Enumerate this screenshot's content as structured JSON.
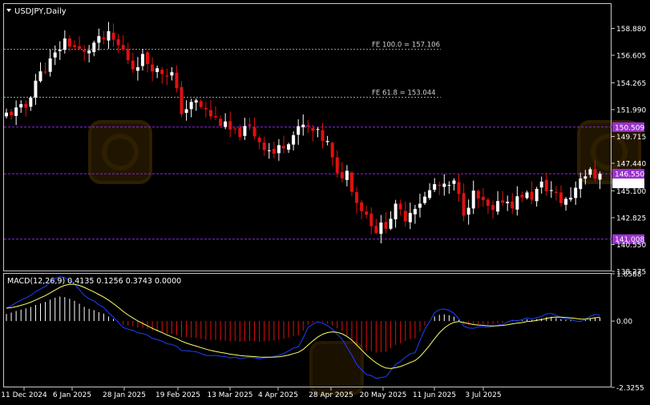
{
  "window": {
    "symbol_title": "USDJPY,Daily",
    "macd_label": "MACD(12,26,9) 0.4135 0.1256 0.3743 0.0000"
  },
  "colors": {
    "background": "#000000",
    "frame": "#c8c8c8",
    "bull": "#ffffff",
    "bear": "#e01010",
    "level_line": "#8a2be2",
    "level_label_bg": "#9932cc",
    "current_price_bg": "#ffffff",
    "fib_line": "#9a9a9a",
    "macd_hist_pos": "#ffffff",
    "macd_hist_neg": "#e01010",
    "macd_line": "#1e40ff",
    "signal_line": "#ffff66",
    "watermark": "#2a1c00"
  },
  "chart_data": [
    {
      "type": "candlestick",
      "symbol": "USDJPY",
      "timeframe": "Daily",
      "ylim": [
        138.275,
        160.95
      ],
      "y_ticks": [
        "158.880",
        "156.605",
        "154.265",
        "151.990",
        "149.715",
        "147.440",
        "145.100",
        "142.825",
        "140.550",
        "138.275"
      ],
      "x_ticks": [
        "11 Dec 2024",
        "6 Jan 2025",
        "28 Jan 2025",
        "19 Feb 2025",
        "13 Mar 2025",
        "4 Apr 2025",
        "28 Apr 2025",
        "20 May 2025",
        "11 Jun 2025",
        "3 Jul 2025"
      ],
      "anchors": [
        [
          0,
          151.6
        ],
        [
          4,
          152.2
        ],
        [
          6,
          154.5
        ],
        [
          10,
          156.6
        ],
        [
          12,
          157.9
        ],
        [
          16,
          156.7
        ],
        [
          18,
          157.6
        ],
        [
          21,
          158.2
        ],
        [
          24,
          157.0
        ],
        [
          26,
          155.6
        ],
        [
          28,
          156.4
        ],
        [
          31,
          155.3
        ],
        [
          34,
          155.0
        ],
        [
          36,
          151.9
        ],
        [
          39,
          152.6
        ],
        [
          42,
          151.5
        ],
        [
          44,
          150.9
        ],
        [
          47,
          149.9
        ],
        [
          50,
          150.4
        ],
        [
          53,
          148.9
        ],
        [
          55,
          148.3
        ],
        [
          58,
          149.5
        ],
        [
          61,
          150.6
        ],
        [
          64,
          149.9
        ],
        [
          66,
          149.1
        ],
        [
          68,
          146.3
        ],
        [
          70,
          146.7
        ],
        [
          72,
          144.2
        ],
        [
          74,
          143.1
        ],
        [
          76,
          141.8
        ],
        [
          78,
          142.3
        ],
        [
          80,
          143.6
        ],
        [
          82,
          142.9
        ],
        [
          84,
          143.9
        ],
        [
          86,
          144.5
        ],
        [
          88,
          145.6
        ],
        [
          90,
          145.3
        ],
        [
          92,
          145.7
        ],
        [
          94,
          143.4
        ],
        [
          96,
          144.8
        ],
        [
          98,
          144.0
        ],
        [
          100,
          143.2
        ],
        [
          102,
          144.4
        ],
        [
          104,
          144.0
        ],
        [
          106,
          144.8
        ],
        [
          108,
          144.6
        ],
        [
          110,
          145.6
        ],
        [
          112,
          145.1
        ],
        [
          114,
          144.2
        ],
        [
          116,
          144.6
        ],
        [
          118,
          146.4
        ],
        [
          120,
          146.6
        ],
        [
          122,
          146.0
        ]
      ],
      "last_price": 146.55,
      "levels": [
        150.509,
        146.55,
        141.008
      ],
      "level_labels": [
        "150.509",
        "146.550",
        "141.008"
      ],
      "fib_levels": [
        157.106,
        153.044
      ],
      "fib_labels": [
        "FE 100.0 = 157.106",
        "FE 61.8 = 153.044"
      ]
    },
    {
      "type": "macd",
      "params": [
        12,
        26,
        9
      ],
      "values": [
        0.4135,
        0.1256,
        0.3743,
        0.0
      ],
      "ylim": [
        -2.3255,
        1.6588
      ],
      "y_ticks": [
        "1.6588",
        "0.00",
        "-2.3255"
      ],
      "anchors": [
        [
          0,
          0.45
        ],
        [
          3,
          0.7
        ],
        [
          6,
          1.0
        ],
        [
          9,
          1.35
        ],
        [
          11,
          1.55
        ],
        [
          13,
          1.45
        ],
        [
          16,
          0.9
        ],
        [
          20,
          0.45
        ],
        [
          24,
          -0.2
        ],
        [
          28,
          -0.45
        ],
        [
          32,
          -0.7
        ],
        [
          36,
          -1.0
        ],
        [
          40,
          -1.15
        ],
        [
          44,
          -1.25
        ],
        [
          48,
          -1.3
        ],
        [
          52,
          -1.3
        ],
        [
          56,
          -1.2
        ],
        [
          60,
          -0.9
        ],
        [
          62,
          -0.25
        ],
        [
          64,
          -0.05
        ],
        [
          66,
          -0.15
        ],
        [
          68,
          -0.45
        ],
        [
          70,
          -0.9
        ],
        [
          72,
          -1.5
        ],
        [
          74,
          -1.85
        ],
        [
          76,
          -2.0
        ],
        [
          78,
          -1.95
        ],
        [
          80,
          -1.55
        ],
        [
          82,
          -1.25
        ],
        [
          84,
          -1.1
        ],
        [
          86,
          -0.3
        ],
        [
          88,
          0.3
        ],
        [
          90,
          0.45
        ],
        [
          92,
          0.25
        ],
        [
          94,
          -0.15
        ],
        [
          96,
          -0.25
        ],
        [
          100,
          -0.2
        ],
        [
          104,
          0.0
        ],
        [
          108,
          0.1
        ],
        [
          112,
          0.25
        ],
        [
          116,
          0.05
        ],
        [
          118,
          -0.05
        ],
        [
          120,
          0.2
        ],
        [
          122,
          0.25
        ]
      ]
    }
  ]
}
